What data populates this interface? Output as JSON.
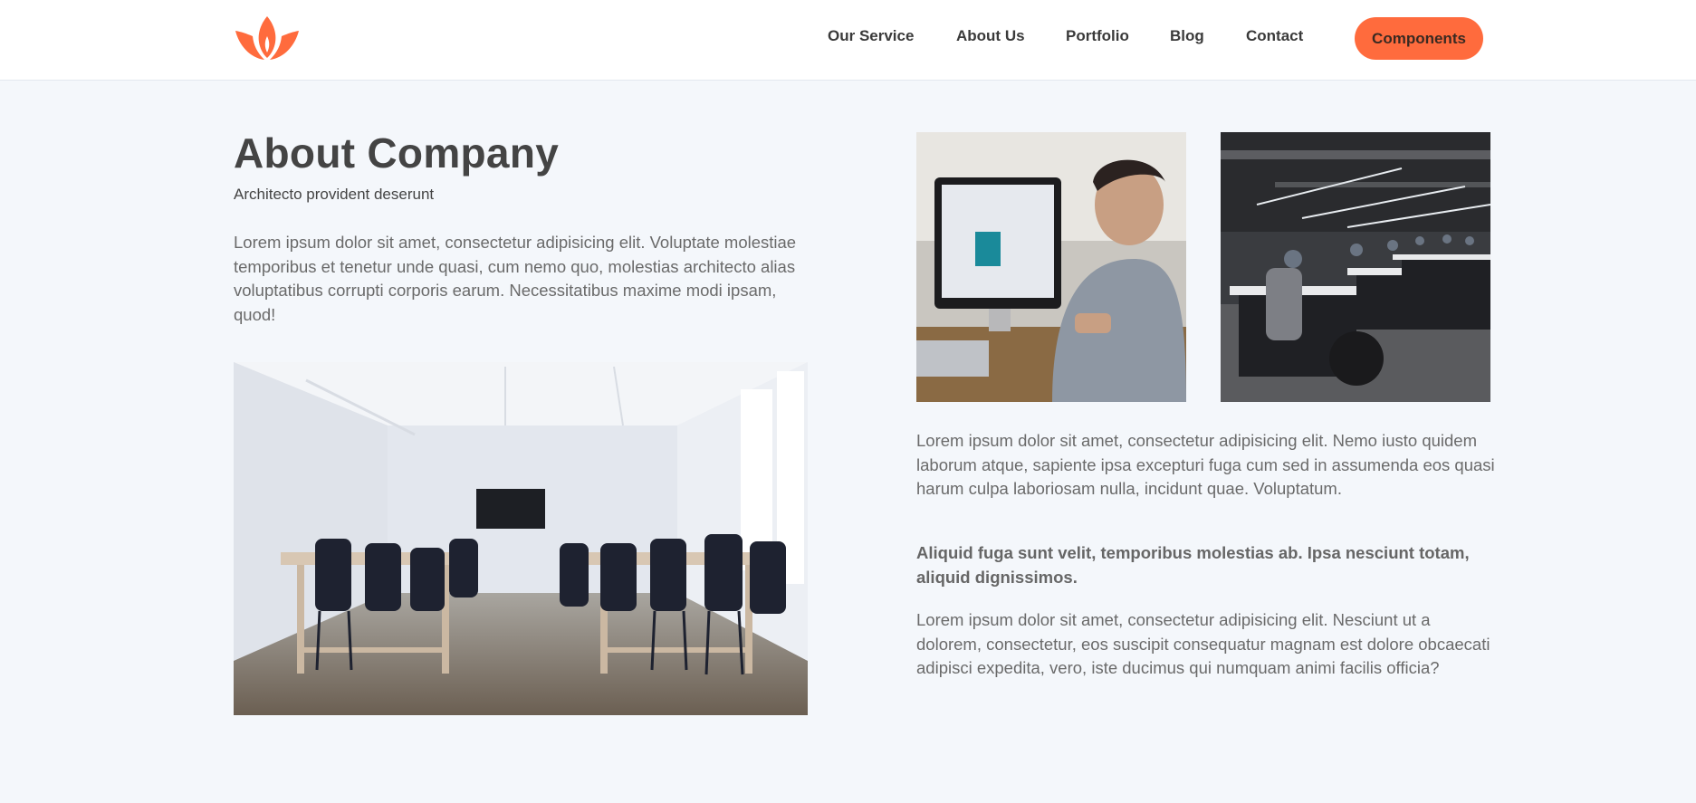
{
  "header": {
    "logo_icon": "lotus-flame-icon",
    "nav": [
      "Our Service",
      "About Us",
      "Portfolio",
      "Blog",
      "Contact"
    ],
    "cta_label": "Components"
  },
  "about": {
    "title": "About Company",
    "subtitle": "Architecto provident deserunt",
    "intro": "Lorem ipsum dolor sit amet, consectetur adipisicing elit. Voluptate molestiae temporibus et tenetur unde quasi, cum nemo quo, molestias architecto alias voluptatibus corrupti corporis earum. Necessitatibus maxime modi ipsam, quod!",
    "para1": "Lorem ipsum dolor sit amet, consectetur adipisicing elit. Nemo iusto quidem laborum atque, sapiente ipsa excepturi fuga cum sed in assumenda eos quasi harum culpa laboriosam nulla, incidunt quae. Voluptatum.",
    "para_bold": "Aliquid fuga sunt velit, temporibus molestias ab. Ipsa nesciunt totam, aliquid dignissimos.",
    "para2": "Lorem ipsum dolor sit amet, consectetur adipisicing elit. Nesciunt ut a dolorem, consectetur, eos suscipit consequatur magnam est dolore obcaecati adipisci expedita, vero, iste ducimus qui numquam animi facilis officia?"
  },
  "colors": {
    "accent": "#ff6b3d",
    "background": "#f4f7fb",
    "header_bg": "#ffffff"
  }
}
